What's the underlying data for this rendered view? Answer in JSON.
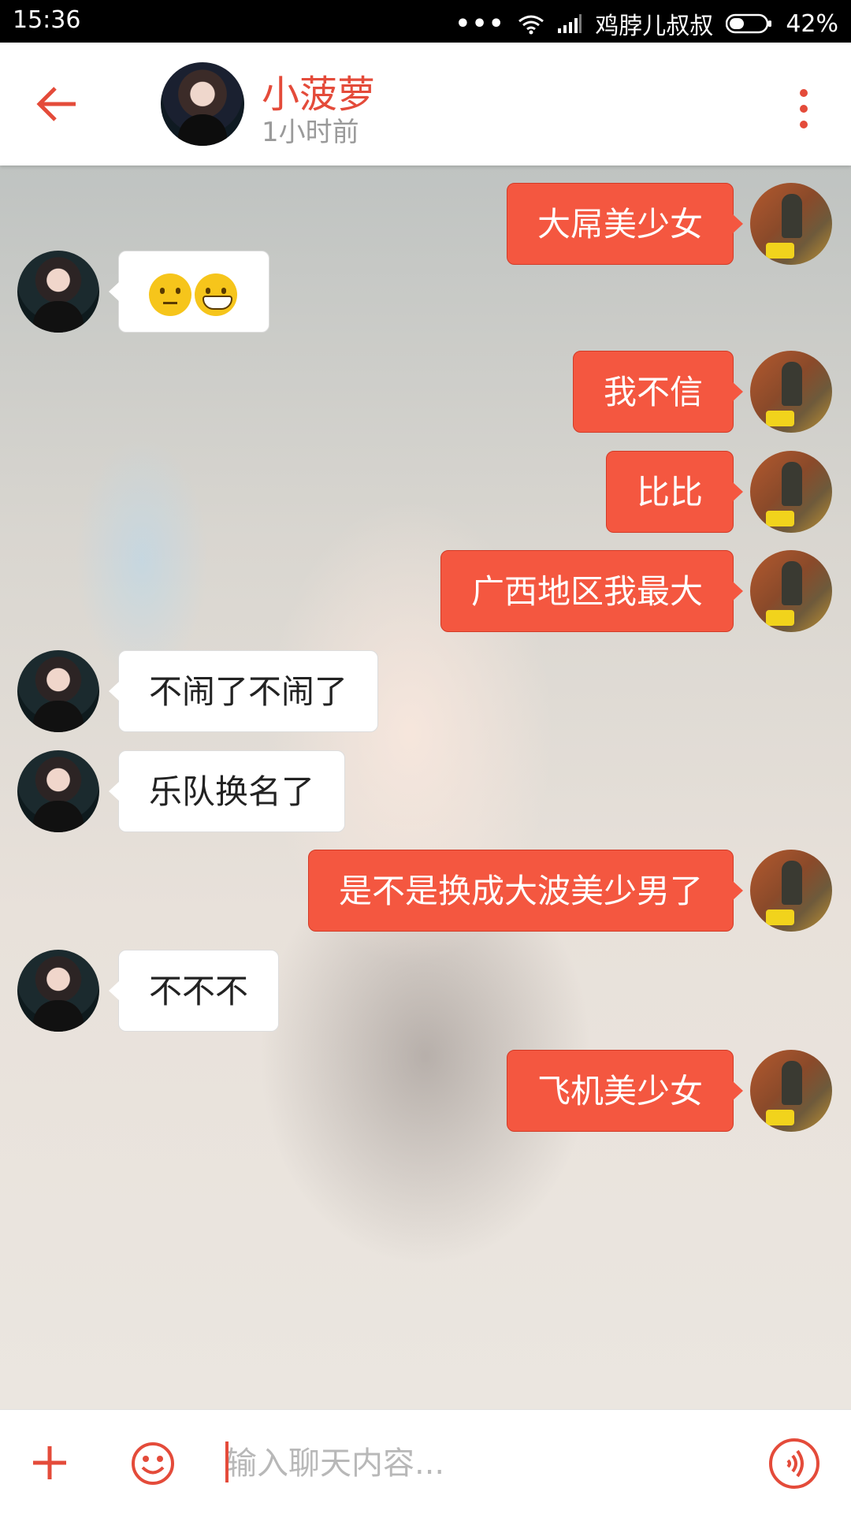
{
  "status_bar": {
    "time": "15:36",
    "dots": "•••",
    "carrier": "鸡脖儿叔叔",
    "battery": "42%",
    "battery_level": 0.42
  },
  "header": {
    "title": "小菠萝",
    "subtitle": "1小时前"
  },
  "messages": [
    {
      "from": "me",
      "text": "大屌美少女"
    },
    {
      "from": "her",
      "text": "",
      "emojis": [
        "neutral-face",
        "grinning-face"
      ]
    },
    {
      "from": "me",
      "text": "我不信"
    },
    {
      "from": "me",
      "text": "比比"
    },
    {
      "from": "me",
      "text": "广西地区我最大"
    },
    {
      "from": "her",
      "text": "不闹了不闹了"
    },
    {
      "from": "her",
      "text": "乐队换名了"
    },
    {
      "from": "me",
      "text": "是不是换成大波美少男了"
    },
    {
      "from": "her",
      "text": "不不不"
    },
    {
      "from": "me",
      "text": "飞机美少女"
    }
  ],
  "input": {
    "placeholder": "输入聊天内容..."
  },
  "colors": {
    "accent": "#e44b3a",
    "my_bubble": "#f45740",
    "her_bubble": "#ffffff"
  },
  "icons": {
    "back": "back-arrow-icon",
    "more": "more-vertical-icon",
    "plus": "plus-icon",
    "emoji": "smiley-icon",
    "voice": "voice-icon"
  }
}
